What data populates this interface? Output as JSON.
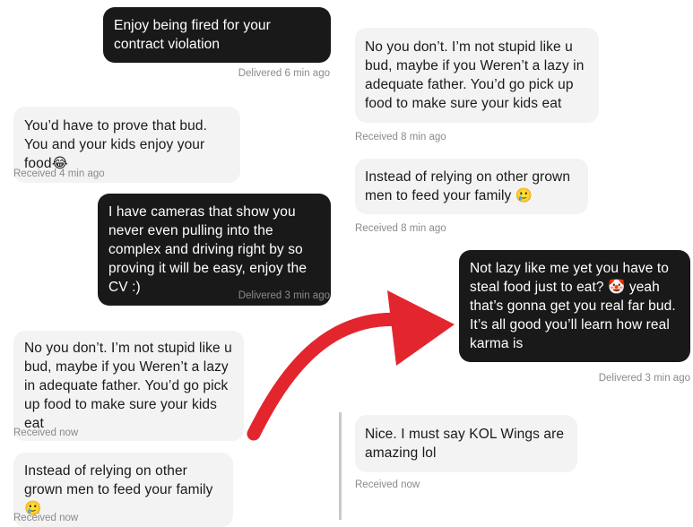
{
  "left": {
    "m1": {
      "text": "Enjoy being fired for your contract violation",
      "status": "Delivered 6 min ago"
    },
    "m2": {
      "text": "You’d have to prove that bud. You and your kids enjoy your food😂",
      "status": "Received 4 min ago"
    },
    "m3": {
      "text": "I have cameras that show you never even pulling into the complex and driving right by so proving it will be easy, enjoy the CV :)",
      "status": "Delivered 3 min ago"
    },
    "m4": {
      "text": "No you don’t. I’m not stupid like u bud, maybe if you Weren’t a lazy in adequate father. You’d go pick up food to make sure your kids eat",
      "status": "Received now"
    },
    "m5": {
      "text": "Instead of relying on other grown men to feed your family 🥲",
      "status": "Received now"
    }
  },
  "right": {
    "m1": {
      "text": "No you don’t. I’m not stupid like u bud, maybe if you Weren’t a lazy in adequate father. You’d go pick up food to make sure your kids eat",
      "status": "Received 8 min ago"
    },
    "m2": {
      "text": "Instead of relying on other grown men to feed your family 🥲",
      "status": "Received 8 min ago"
    },
    "m3": {
      "text": "Not lazy like me yet you have to steal food just to eat? 🤡 yeah that’s gonna get you real far bud. It’s all good you’ll learn how real karma is",
      "status": "Delivered 3 min ago"
    },
    "m4": {
      "text": "Nice. I must say KOL Wings are amazing lol",
      "status": "Received now"
    }
  },
  "colors": {
    "sent_bubble": "#191919",
    "received_bubble": "#f3f3f3",
    "status_text": "#8a8a8a",
    "arrow": "#e3262e"
  },
  "icons": [
    "curved-arrow-icon"
  ]
}
